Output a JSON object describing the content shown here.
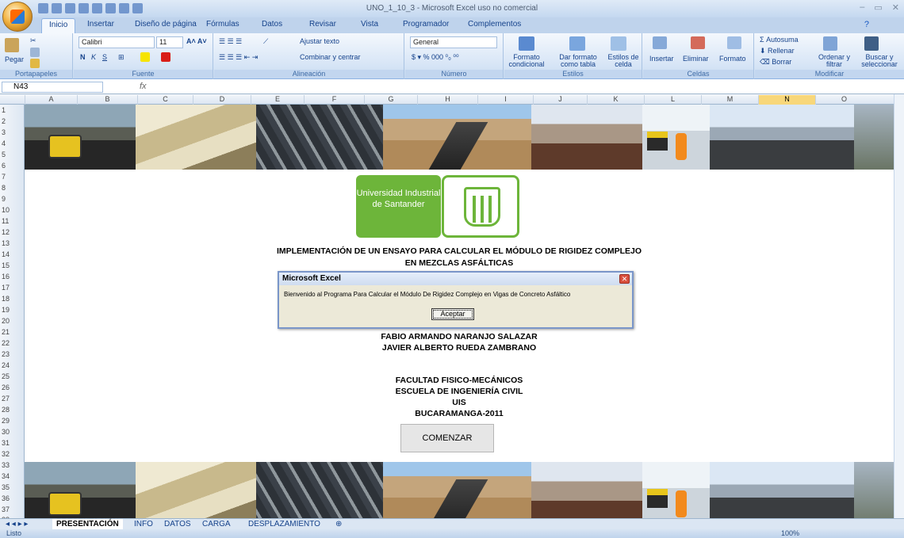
{
  "window": {
    "title": "UNO_1_10_3 - Microsoft Excel uso no comercial"
  },
  "tabs": [
    "Inicio",
    "Insertar",
    "Diseño de página",
    "Fórmulas",
    "Datos",
    "Revisar",
    "Vista",
    "Programador",
    "Complementos"
  ],
  "ribbon": {
    "portapapeles": {
      "pegar": "Pegar",
      "label": "Portapapeles"
    },
    "fuente": {
      "font": "Calibri",
      "size": "11",
      "label": "Fuente"
    },
    "alineacion": {
      "ajustar": "Ajustar texto",
      "combinar": "Combinar y centrar",
      "label": "Alineación"
    },
    "numero": {
      "format": "General",
      "label": "Número"
    },
    "estilos": {
      "formato_condicional": "Formato condicional",
      "dar_formato": "Dar formato como tabla",
      "estilos_celda": "Estilos de celda",
      "label": "Estilos"
    },
    "celdas": {
      "insertar": "Insertar",
      "eliminar": "Eliminar",
      "formato": "Formato",
      "label": "Celdas"
    },
    "modificar": {
      "autosuma": "Autosuma",
      "rellenar": "Rellenar",
      "borrar": "Borrar",
      "ordenar": "Ordenar y filtrar",
      "buscar": "Buscar y seleccionar",
      "label": "Modificar"
    }
  },
  "namebox": "N43",
  "columns": [
    "A",
    "B",
    "C",
    "D",
    "E",
    "F",
    "G",
    "H",
    "I",
    "J",
    "K",
    "L",
    "M",
    "N",
    "O"
  ],
  "rows": [
    "1",
    "2",
    "3",
    "4",
    "5",
    "6",
    "7",
    "8",
    "9",
    "10",
    "11",
    "12",
    "13",
    "14",
    "15",
    "16",
    "17",
    "18",
    "19",
    "20",
    "21",
    "22",
    "23",
    "24",
    "25",
    "26",
    "27",
    "28",
    "29",
    "30",
    "31",
    "32",
    "33",
    "34",
    "35",
    "36",
    "37",
    "38"
  ],
  "content": {
    "logo_text": "Universidad Industrial de Santander",
    "title_line1": "IMPLEMENTACIÓN DE UN ENSAYO PARA CALCULAR  EL MÓDULO DE RIGIDEZ COMPLEJO",
    "title_line2": "EN MEZCLAS ASFÁLTICAS",
    "author1": "FABIO ARMANDO NARANJO SALAZAR",
    "author2": "JAVIER ALBERTO RUEDA ZAMBRANO",
    "fac1": "FACULTAD FISICO-MECÁNICOS",
    "fac2": "ESCUELA DE INGENIERÍA CIVIL",
    "fac3": "UIS",
    "fac4": "BUCARAMANGA-2011",
    "comenzar": "COMENZAR"
  },
  "dialog": {
    "title": "Microsoft Excel",
    "message": "Bienvenido al Programa Para Calcular el Módulo De Rigidez Complejo en Vigas de Concreto Asfáltico",
    "button": "Aceptar"
  },
  "sheets": [
    "PRESENTACIÓN",
    "INFO",
    "DATOS",
    "CARGA",
    "DESPLAZAMIENTO"
  ],
  "status": {
    "ready": "Listo",
    "zoom": "100%"
  }
}
